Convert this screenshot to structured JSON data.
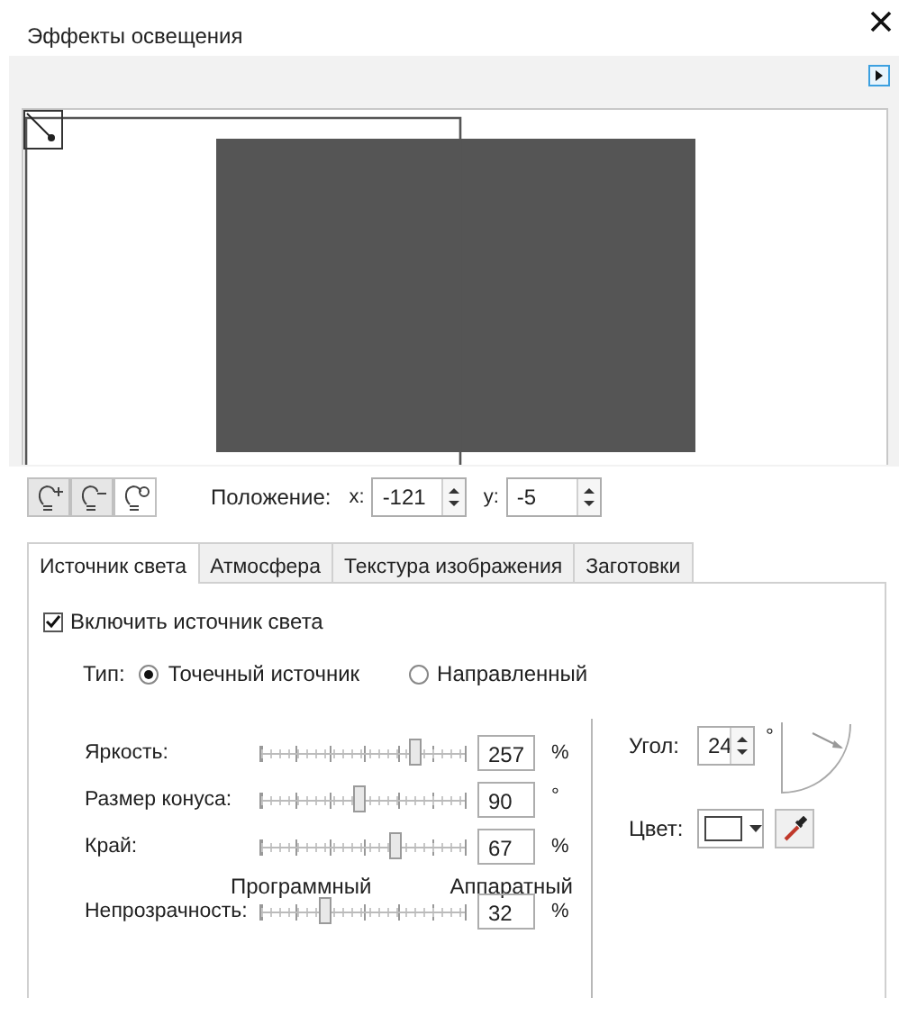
{
  "window": {
    "title": "Эффекты освещения"
  },
  "position": {
    "label": "Положение:",
    "x_label": "x:",
    "x_value": "-121",
    "y_label": "y:",
    "y_value": "-5"
  },
  "tabs": [
    {
      "label": "Источник света",
      "selected": true
    },
    {
      "label": "Атмосфера",
      "selected": false
    },
    {
      "label": "Текстура изображения",
      "selected": false
    },
    {
      "label": "Заготовки",
      "selected": false
    }
  ],
  "enable_light": {
    "label": "Включить источник света",
    "checked": true
  },
  "type": {
    "label": "Тип:",
    "options": [
      {
        "label": "Точечный источник",
        "selected": true
      },
      {
        "label": "Направленный",
        "selected": false
      }
    ]
  },
  "sliders": [
    {
      "label": "Яркость:",
      "level": 0.76,
      "value": "257",
      "unit": "%"
    },
    {
      "label": "Размер конуса:",
      "level": 0.49,
      "value": "90",
      "unit": "°"
    },
    {
      "label": "Край:",
      "level": 0.66,
      "value": "67",
      "unit": "%"
    },
    {
      "label": "Непрозрачность:",
      "level": 0.32,
      "value": "32",
      "unit": "%",
      "caption_left": "Программный",
      "caption_right": "Аппаратный"
    }
  ],
  "angle": {
    "label": "Угол:",
    "value": "24",
    "unit": "°"
  },
  "color": {
    "label": "Цвет:"
  }
}
